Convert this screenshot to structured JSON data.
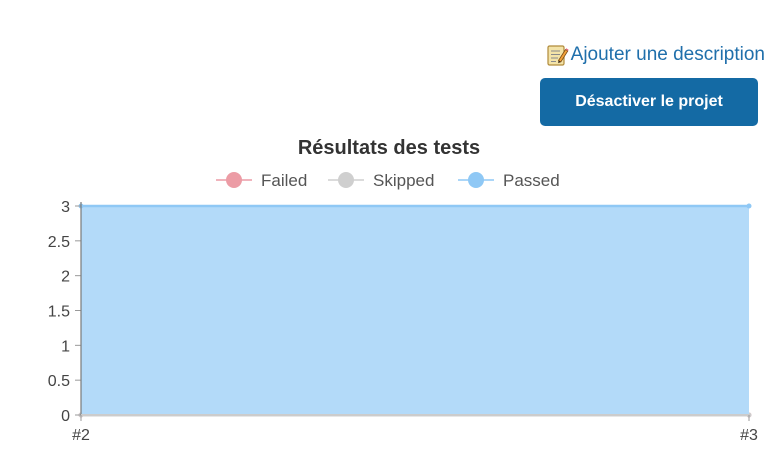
{
  "header": {
    "description_link_label": "Ajouter une description",
    "description_icon": "memo-icon",
    "disable_button_label": "Désactiver le projet"
  },
  "colors": {
    "link": "#1f6fab",
    "button_bg": "#146aa4",
    "button_text": "#ffffff"
  },
  "chart_data": {
    "type": "area",
    "title": "Résultats des tests",
    "categories": [
      "#2",
      "#3"
    ],
    "series": [
      {
        "name": "Failed",
        "values": [
          0,
          0
        ],
        "color": "#ec9ca5"
      },
      {
        "name": "Skipped",
        "values": [
          0,
          0
        ],
        "color": "#cfcfcf"
      },
      {
        "name": "Passed",
        "values": [
          3,
          3
        ],
        "color": "#8fc8f5",
        "fill": "#b3daf9"
      }
    ],
    "stacked": true,
    "ylim": [
      0,
      3
    ],
    "yticks": [
      "0",
      "0.5",
      "1",
      "1.5",
      "2",
      "2.5",
      "3"
    ],
    "ytick_values": [
      0,
      0.5,
      1,
      1.5,
      2,
      2.5,
      3
    ],
    "grid": true,
    "legend_position": "top-center"
  }
}
